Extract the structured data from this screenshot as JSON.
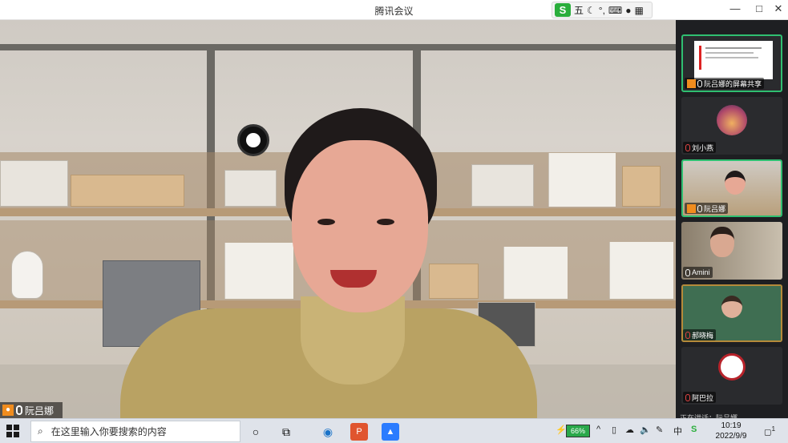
{
  "window": {
    "title": "腾讯会议"
  },
  "ime": {
    "logo": "S",
    "mode": "五",
    "icons": [
      "moon-icon",
      "punctuation-icon",
      "keyboard-icon",
      "user-icon",
      "skin-icon"
    ]
  },
  "window_controls": {
    "minimize": "—",
    "maximize": "□",
    "close": "✕"
  },
  "main_video": {
    "speaker_name": "阮吕娜"
  },
  "participants": [
    {
      "name": "阮吕娜的屏幕共享",
      "type": "screen-share",
      "muted": false
    },
    {
      "name": "刘小燕",
      "type": "avatar",
      "muted": true
    },
    {
      "name": "阮吕娜",
      "type": "video",
      "muted": false
    },
    {
      "name": "Amini",
      "type": "video",
      "muted": false
    },
    {
      "name": "郝晓梅",
      "type": "video",
      "muted": true
    },
    {
      "name": "阿巴拉",
      "type": "avatar",
      "muted": true
    }
  ],
  "chat_preview": "正在讲话：阮吕娜",
  "taskbar": {
    "search_placeholder": "在这里输入你要搜索的内容",
    "battery": "66%",
    "ime_indicator": "中",
    "time": "10:19",
    "date": "2022/9/9",
    "notifications": "1"
  }
}
